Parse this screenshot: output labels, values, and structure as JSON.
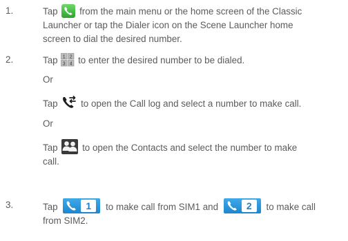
{
  "steps": [
    {
      "number": "1.",
      "tap": "Tap",
      "text_line1": "from the main menu or the home screen of the Classic",
      "text_line2": "Launcher or tap the Dialer icon on the Scene Launcher home",
      "text_line3": "screen to dial the desired number."
    },
    {
      "number": "2.",
      "tap": "Tap",
      "text_line1": "to enter the desired number to be dialed.",
      "or1": "Or",
      "tap2": "Tap",
      "calllog_text": "to open the Call log and select a number to make call.",
      "or2": "Or",
      "tap3": "Tap",
      "contacts_text_line1": "to open the Contacts and select the number to make",
      "contacts_text_line2": "call."
    },
    {
      "number": "3.",
      "tap": "Tap",
      "sim1_label": "1",
      "mid_text": "to make call from SIM1 and",
      "sim2_label": "2",
      "end_text": "to make call",
      "text_line2": "from SIM2."
    }
  ],
  "icons": {
    "phone": "phone-icon",
    "dialpad": "dialpad-icon",
    "calllog": "call-log-icon",
    "contacts": "contacts-icon",
    "sim_call": "sim-call-icon"
  },
  "colors": {
    "text": "#5b5b5b",
    "phone_green": "#3cb33c",
    "sim_blue": "#2a96dc"
  }
}
